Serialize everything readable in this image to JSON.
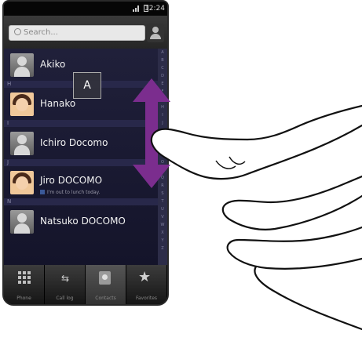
{
  "status_bar": {
    "time": "12:24"
  },
  "search": {
    "placeholder": "Search..."
  },
  "popup_letter": "A",
  "contacts": [
    {
      "name": "Akiko",
      "section": ""
    },
    {
      "name": "Hanako",
      "section": "H"
    },
    {
      "name": "Ichiro Docomo",
      "section": "I"
    },
    {
      "name": "Jiro DOCOMO",
      "section": "J",
      "status": "I'm out to lunch today."
    },
    {
      "name": "Natsuko DOCOMO",
      "section": "N"
    }
  ],
  "index_letters": [
    "A",
    "B",
    "C",
    "D",
    "E",
    "F",
    "G",
    "H",
    "I",
    "J",
    "K",
    "L",
    "M",
    "N",
    "O",
    "P",
    "Q",
    "R",
    "S",
    "T",
    "U",
    "V",
    "W",
    "X",
    "Y",
    "Z"
  ],
  "tabs": [
    {
      "label": "Phone",
      "icon": "dialpad-icon"
    },
    {
      "label": "Call log",
      "icon": "call-log-icon"
    },
    {
      "label": "Contacts",
      "icon": "contacts-icon",
      "active": true
    },
    {
      "label": "Favorites",
      "icon": "star-icon"
    }
  ],
  "colors": {
    "arrow": "#7b2d8e",
    "list_bg": "#1a1a30"
  }
}
